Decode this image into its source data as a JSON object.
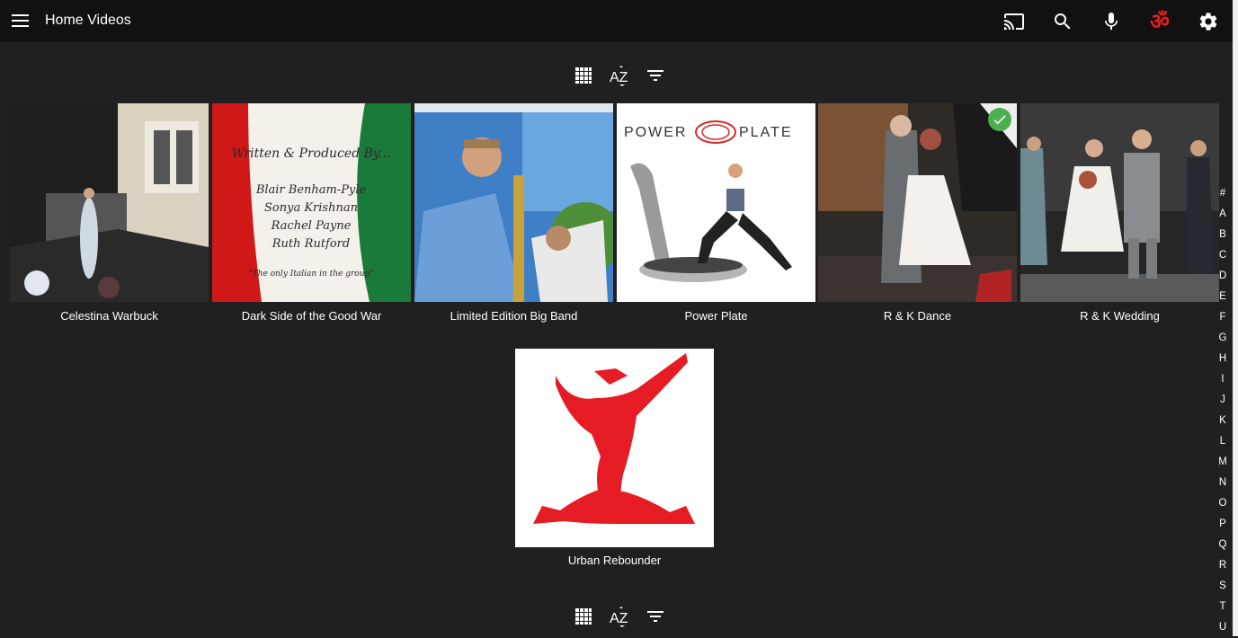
{
  "header": {
    "title": "Home Videos",
    "accent_om_color": "#e0201e"
  },
  "view_controls": {
    "icons": [
      "grid-view-icon",
      "sort-az-icon",
      "filter-icon"
    ],
    "sort_label": "AZ"
  },
  "items": [
    {
      "title": "Celestina Warbuck",
      "played": false
    },
    {
      "title": "Dark Side of the Good War",
      "played": false,
      "thumb_text": [
        "Written & Produced By...",
        "Blair Benham-Pyle",
        "Sonya Krishnan",
        "Rachel Payne",
        "Ruth Rutford",
        "\"The only Italian in the group\""
      ]
    },
    {
      "title": "Limited Edition Big Band",
      "played": false
    },
    {
      "title": "Power Plate",
      "played": false,
      "thumb_text": [
        "POWER",
        "PLATE"
      ]
    },
    {
      "title": "R & K Dance",
      "played": true
    },
    {
      "title": "R & K Wedding",
      "played": false
    },
    {
      "title": "Urban Rebounder",
      "played": false
    }
  ],
  "alpha_index": [
    "#",
    "A",
    "B",
    "C",
    "D",
    "E",
    "F",
    "G",
    "H",
    "I",
    "J",
    "K",
    "L",
    "M",
    "N",
    "O",
    "P",
    "Q",
    "R",
    "S",
    "T",
    "U"
  ]
}
